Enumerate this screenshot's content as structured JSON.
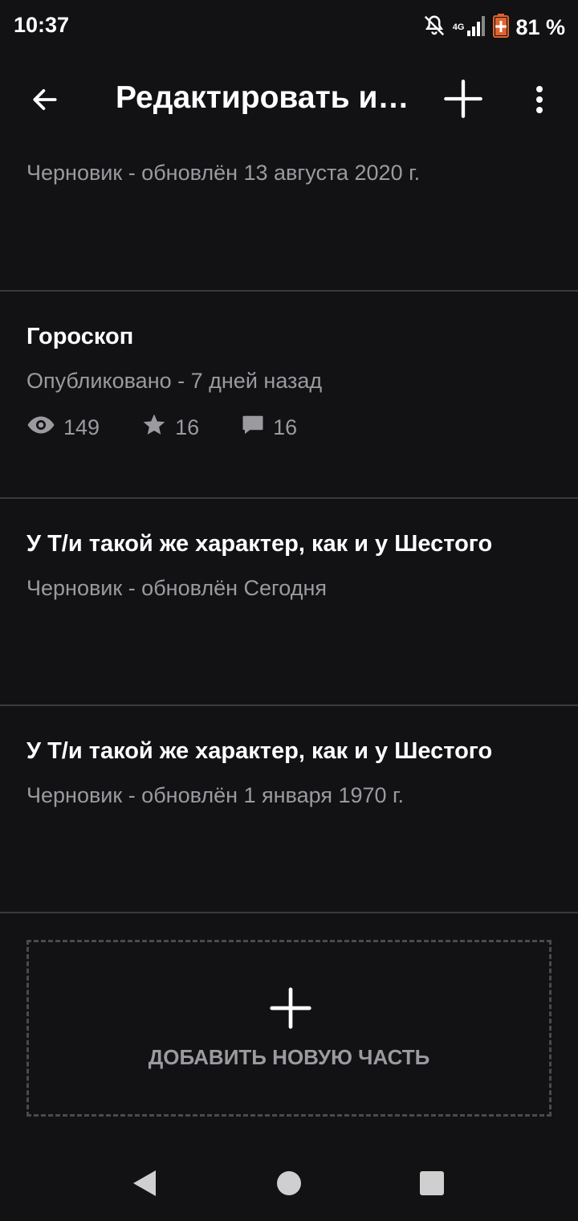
{
  "status_bar": {
    "time": "10:37",
    "network": "4G",
    "battery": "81 %"
  },
  "app_bar": {
    "title": "Редактировать и…",
    "back_icon": "arrow-left-icon",
    "add_icon": "plus-icon",
    "more_icon": "more-vertical-icon"
  },
  "parts": [
    {
      "title": "",
      "status": "Черновик - обновлён 13 августа 2020 г."
    },
    {
      "title": "Гороскоп",
      "status": "Опубликовано - 7 дней назад",
      "stats": {
        "views": "149",
        "votes": "16",
        "comments": "16"
      }
    },
    {
      "title": "У Т/и такой же характер, как и у Шестого",
      "status": "Черновик - обновлён Сегодня"
    },
    {
      "title": "У Т/и такой же характер, как и у Шестого",
      "status": "Черновик - обновлён 1 января 1970 г."
    }
  ],
  "add_part": {
    "label": "ДОБАВИТЬ НОВУЮ ЧАСТЬ"
  },
  "colors": {
    "background": "#121114",
    "text_primary": "#ffffff",
    "text_secondary": "#9b9a9f",
    "divider": "#3a393d"
  }
}
